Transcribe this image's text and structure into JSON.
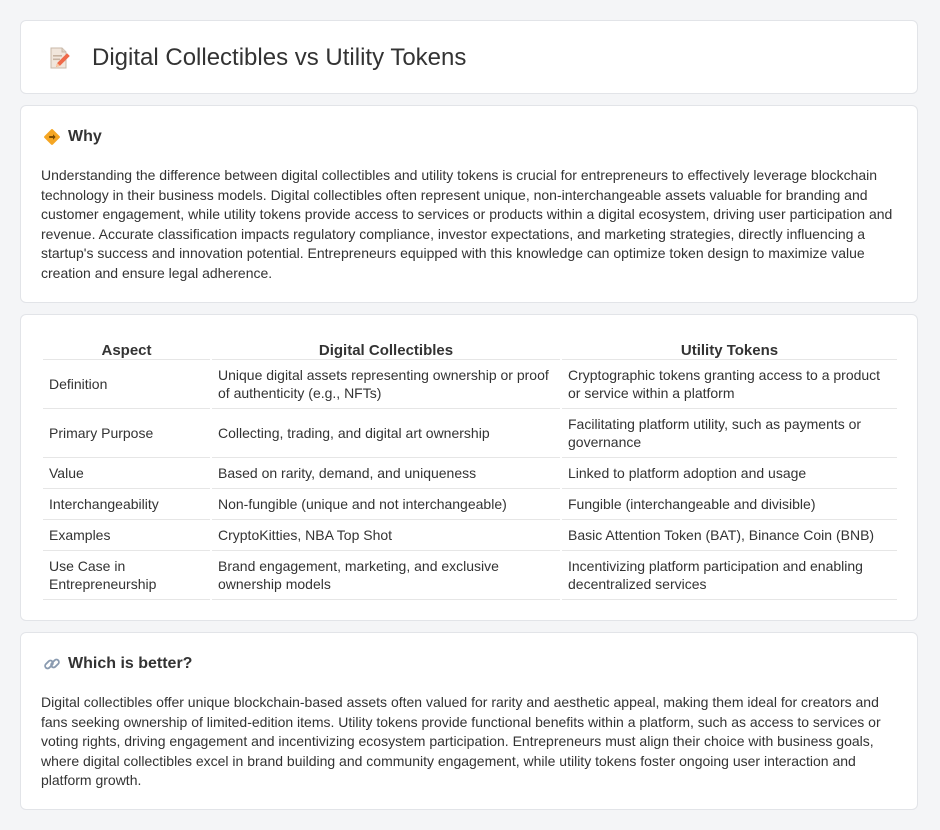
{
  "page": {
    "title": "Digital Collectibles vs Utility Tokens",
    "title_icon": "document-pencil-icon"
  },
  "why": {
    "icon": "diamond-sign-icon",
    "heading": "Why",
    "body": "Understanding the difference between digital collectibles and utility tokens is crucial for entrepreneurs to effectively leverage blockchain technology in their business models. Digital collectibles often represent unique, non-interchangeable assets valuable for branding and customer engagement, while utility tokens provide access to services or products within a digital ecosystem, driving user participation and revenue. Accurate classification impacts regulatory compliance, investor expectations, and marketing strategies, directly influencing a startup's success and innovation potential. Entrepreneurs equipped with this knowledge can optimize token design to maximize value creation and ensure legal adherence."
  },
  "table": {
    "headers": [
      "Aspect",
      "Digital Collectibles",
      "Utility Tokens"
    ],
    "rows": [
      [
        "Definition",
        "Unique digital assets representing ownership or proof of authenticity (e.g., NFTs)",
        "Cryptographic tokens granting access to a product or service within a platform"
      ],
      [
        "Primary Purpose",
        "Collecting, trading, and digital art ownership",
        "Facilitating platform utility, such as payments or governance"
      ],
      [
        "Value",
        "Based on rarity, demand, and uniqueness",
        "Linked to platform adoption and usage"
      ],
      [
        "Interchangeability",
        "Non-fungible (unique and not interchangeable)",
        "Fungible (interchangeable and divisible)"
      ],
      [
        "Examples",
        "CryptoKitties, NBA Top Shot",
        "Basic Attention Token (BAT), Binance Coin (BNB)"
      ],
      [
        "Use Case in Entrepreneurship",
        "Brand engagement, marketing, and exclusive ownership models",
        "Incentivizing platform participation and enabling decentralized services"
      ]
    ]
  },
  "better": {
    "icon": "link-icon",
    "heading": "Which is better?",
    "body": "Digital collectibles offer unique blockchain-based assets often valued for rarity and aesthetic appeal, making them ideal for creators and fans seeking ownership of limited-edition items. Utility tokens provide functional benefits within a platform, such as access to services or voting rights, driving engagement and incentivizing ecosystem participation. Entrepreneurs must align their choice with business goals, where digital collectibles excel in brand building and community engagement, while utility tokens foster ongoing user interaction and platform growth."
  }
}
